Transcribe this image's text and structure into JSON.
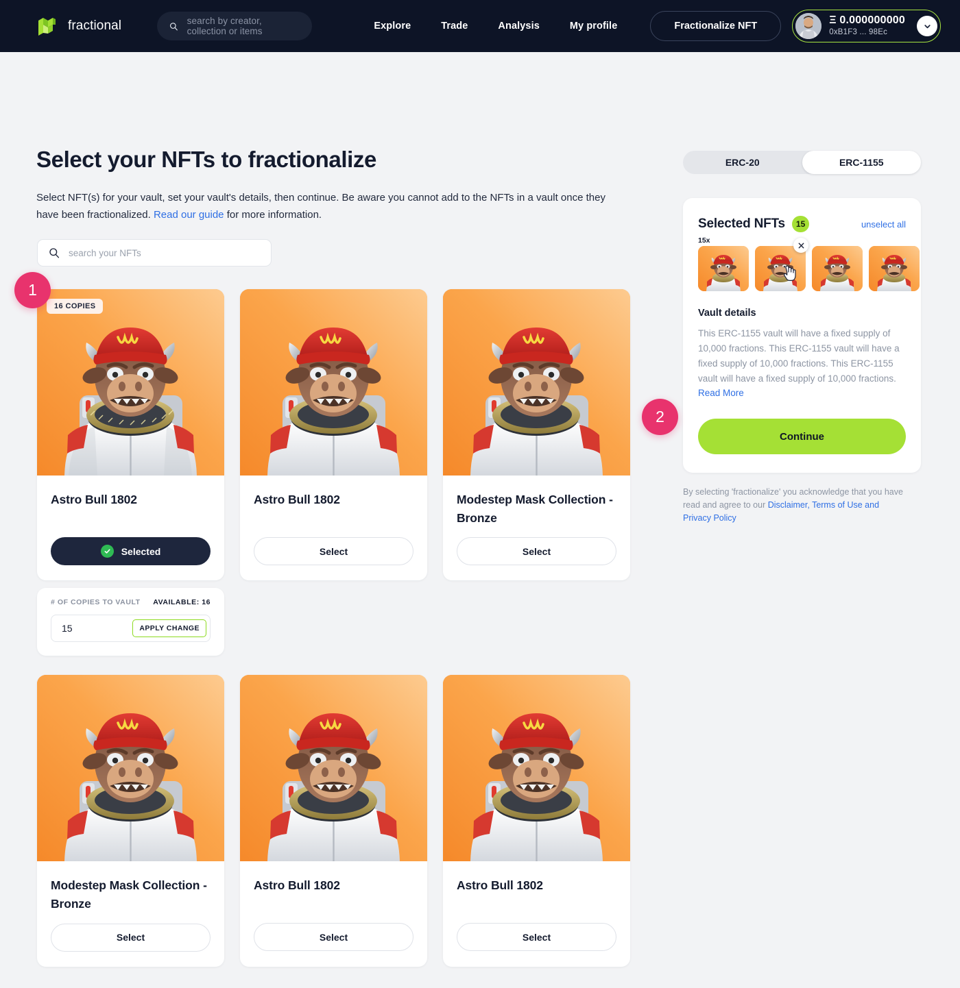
{
  "header": {
    "brand": "fractional",
    "search_placeholder": "search by creator, collection or items",
    "nav": [
      {
        "label": "Explore"
      },
      {
        "label": "Trade"
      },
      {
        "label": "Analysis"
      },
      {
        "label": "My profile"
      }
    ],
    "fractionalize_label": "Fractionalize NFT",
    "wallet": {
      "balance": "Ξ 0.000000000",
      "address": "0xB1F3 ... 98Ec"
    }
  },
  "main": {
    "title": "Select your NFTs to fractionalize",
    "subtitle_part1": "Select NFT(s) for your vault, set your vault's details, then continue. Be aware you cannot add to the NFTs in a vault once they have been fractionalized. ",
    "subtitle_link": "Read our guide",
    "subtitle_part2": " for more information.",
    "search_placeholder": "search your NFTs",
    "cards": [
      {
        "title": "Astro Bull 1802",
        "badge": "16 COPIES",
        "button": "Selected",
        "selected": true
      },
      {
        "title": "Astro Bull 1802",
        "badge": "",
        "button": "Select",
        "selected": false
      },
      {
        "title": "Modestep Mask Collection - Bronze",
        "badge": "",
        "button": "Select",
        "selected": false
      },
      {
        "title": "Modestep Mask Collection - Bronze",
        "badge": "",
        "button": "Select",
        "selected": false
      },
      {
        "title": "Astro Bull 1802",
        "badge": "",
        "button": "Select",
        "selected": false
      },
      {
        "title": "Astro Bull 1802",
        "badge": "",
        "button": "Select",
        "selected": false
      }
    ],
    "copies_panel": {
      "label": "# OF COPIES TO VAULT",
      "available": "AVAILABLE: 16",
      "value": "15",
      "apply_label": "APPLY CHANGE"
    },
    "steps": [
      {
        "number": "1"
      },
      {
        "number": "2"
      }
    ]
  },
  "sidebar": {
    "toggle": {
      "option_1": "ERC-20",
      "option_2": "ERC-1155",
      "active": "ERC-1155"
    },
    "panel": {
      "title": "Selected NFTs",
      "count": "15",
      "unselect_all": "unselect all",
      "thumb_multiplier": "15x",
      "vault_details_title": "Vault details",
      "vault_details_text": "This ERC-1155 vault will have a fixed supply of 10,000 fractions. This ERC-1155 vault will have a fixed supply of 10,000 fractions. This ERC-1155 vault will have a fixed supply of 10,000 fractions. ",
      "read_more": "Read More",
      "continue_label": "Continue"
    },
    "legal_text": "By selecting 'fractionalize' you acknowledge that you have read and agree to our ",
    "legal_link": "Disclaimer, Terms of Use and Privacy Policy"
  },
  "colors": {
    "header_bg": "#0d1426",
    "accent_green": "#a5e035",
    "accent_pink": "#e8336d",
    "link_blue": "#2f6fe4",
    "nft_orange": "#fba449",
    "dark_navy": "#1e263d"
  }
}
